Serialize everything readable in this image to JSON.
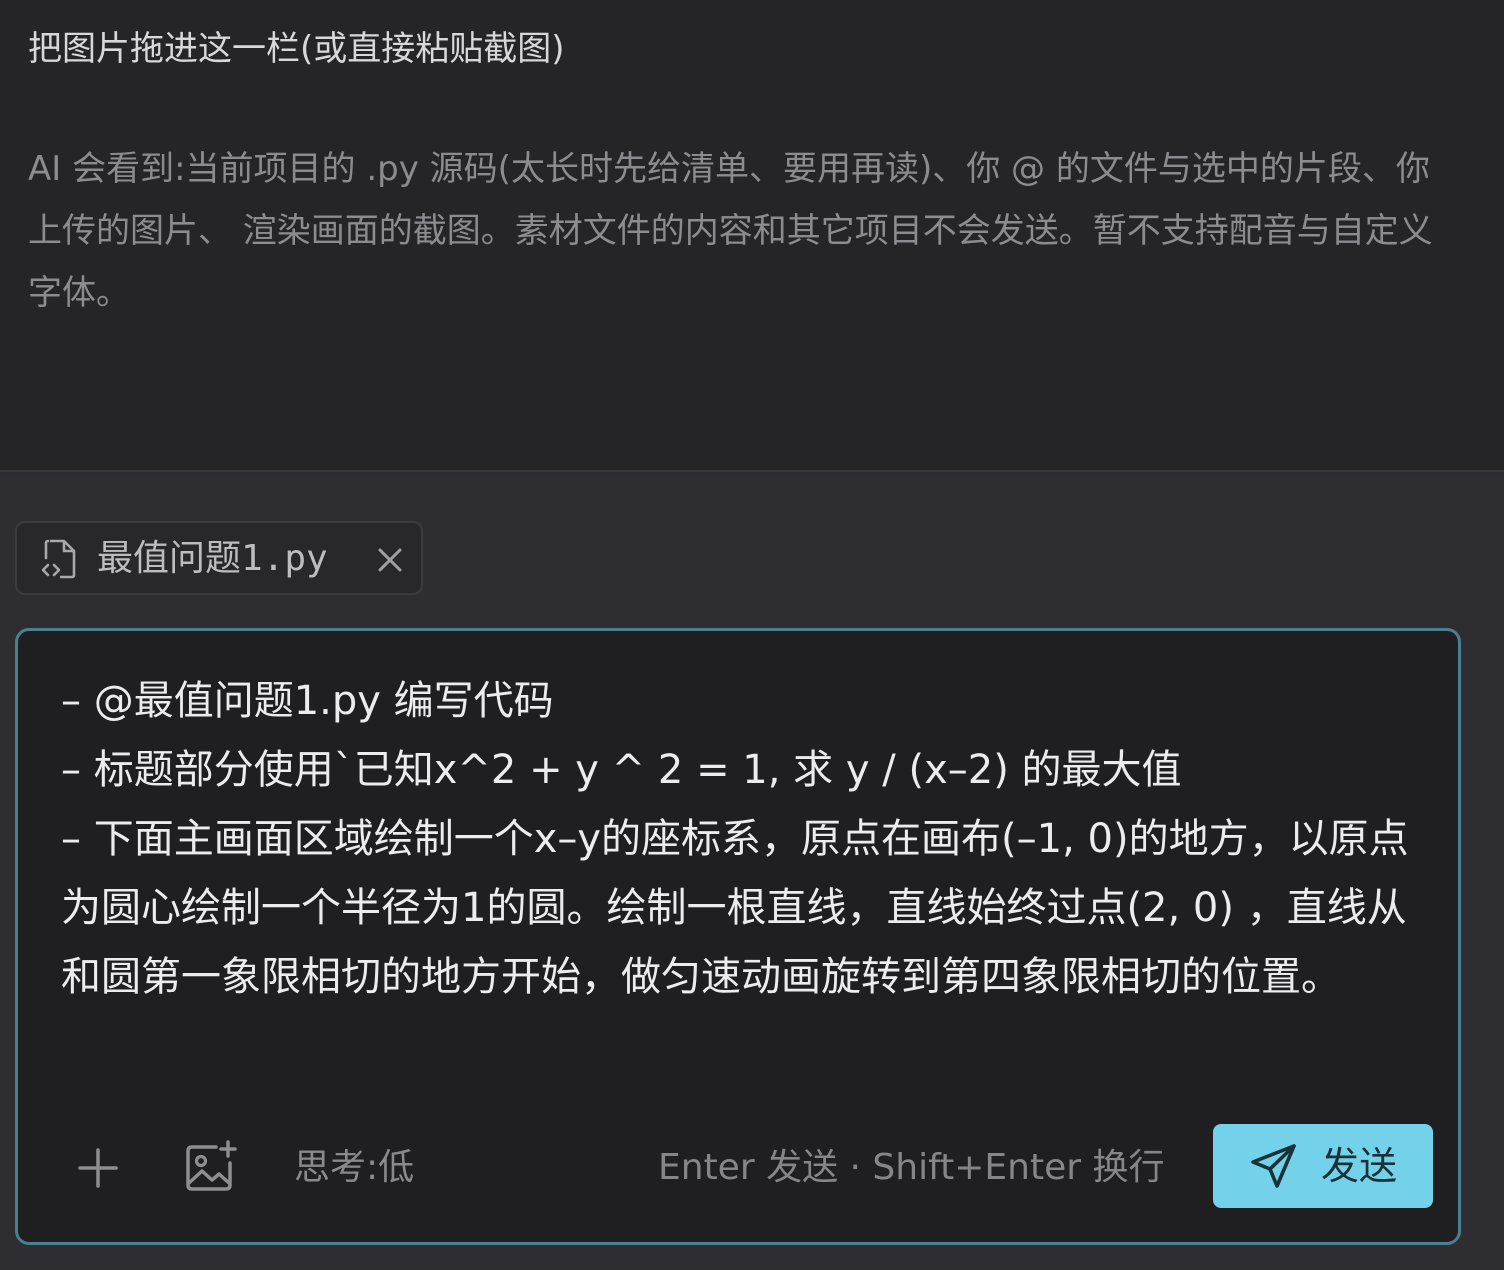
{
  "info": {
    "title": "把图片拖进这一栏(或直接粘贴截图)",
    "description": "AI 会看到:当前项目的 .py 源码(太长时先给清单、要用再读)、你 @ 的文件与选中的片段、你上传的图片、 渲染画面的截图。素材文件的内容和其它项目不会发送。暂不支持配音与自定义字体。"
  },
  "attachment": {
    "file_name": "最值问题1.py",
    "icon": "file-code-icon"
  },
  "composer": {
    "text": "– @最值问题1.py 编写代码\n– 标题部分使用`已知x^2 + y ^ 2 = 1, 求 y / (x–2) 的最大值\n– 下面主画面区域绘制一个x–y的座标系，原点在画布(–1, 0)的地方，以原点为圆心绘制一个半径为1的圆。绘制一根直线，直线始终过点(2, 0) ，直线从和圆第一象限相切的地方开始，做匀速动画旋转到第四象限相切的位置。",
    "thinking_label": "思考:低",
    "hint": "Enter 发送 · Shift+Enter 换行",
    "send_label": "发送"
  },
  "colors": {
    "accent_border": "#4a7f8f",
    "send_button": "#74d1ea"
  }
}
